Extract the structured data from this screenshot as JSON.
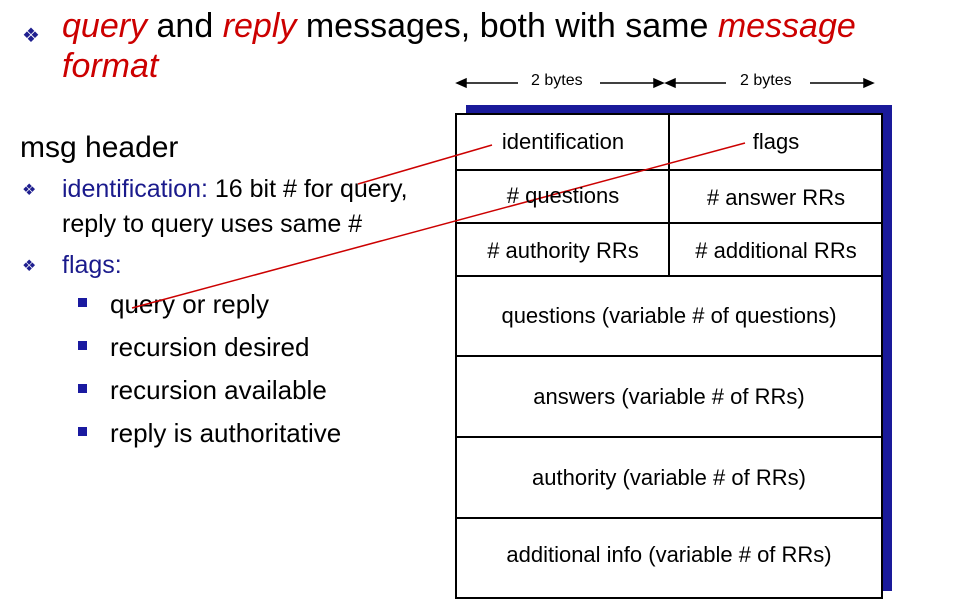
{
  "title": {
    "word1": "query",
    "mid1": " and ",
    "word2": "reply",
    "mid2": " messages, both with same ",
    "word3": "message format"
  },
  "bytes_label_left": "2 bytes",
  "bytes_label_right": "2 bytes",
  "left_panel": {
    "header": "msg header",
    "items": [
      {
        "term": "identification:",
        "rest": " 16 bit # for query, reply to query uses same #"
      },
      {
        "term": "flags:",
        "rest": ""
      }
    ],
    "flags": [
      "query or reply",
      "recursion desired",
      "recursion available",
      "reply is authoritative"
    ]
  },
  "diagram": {
    "rows": [
      [
        "identification",
        "flags"
      ],
      [
        "# questions",
        "# answer RRs"
      ],
      [
        "# authority RRs",
        "# additional RRs"
      ]
    ],
    "sections": [
      "questions (variable # of questions)",
      "answers (variable # of RRs)",
      "authority (variable # of RRs)",
      "additional info (variable # of RRs)"
    ]
  },
  "colors": {
    "accent": "#cc0000",
    "bullet": "#1a1a8c",
    "shadow": "#1a1a9a"
  }
}
